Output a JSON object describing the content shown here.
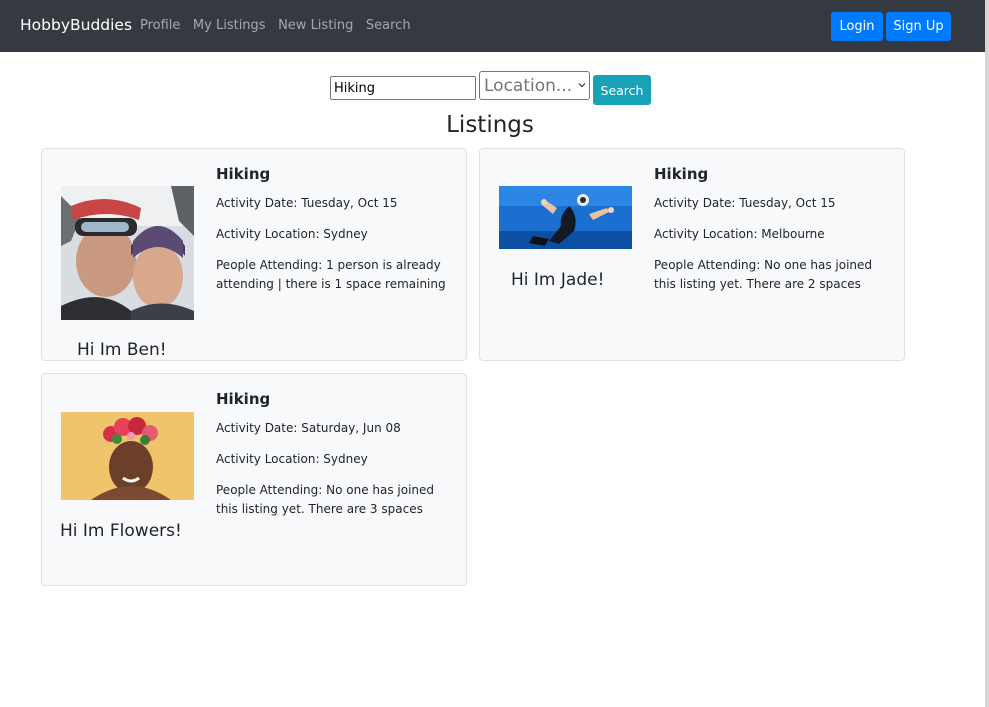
{
  "navbar": {
    "brand": "HobbyBuddies",
    "links": [
      "Profile",
      "My Listings",
      "New Listing",
      "Search"
    ],
    "login": "Login",
    "signup": "Sign Up",
    "bg_color": "#343a40"
  },
  "search": {
    "query": "Hiking",
    "location_placeholder": "Location...",
    "button": "Search",
    "button_color": "#17a2b8"
  },
  "heading": "Listings",
  "listings": [
    {
      "title": "Hiking",
      "date": "Activity Date: Tuesday, Oct 15",
      "location": "Activity Location: Sydney",
      "attending": "People Attending: 1 person is already attending | there is 1 space remaining",
      "greeting": "Hi Im Ben!",
      "photo_icon": "couple-selfie-photo"
    },
    {
      "title": "Hiking",
      "date": "Activity Date: Tuesday, Oct 15",
      "location": "Activity Location: Melbourne",
      "attending": "People Attending: No one has joined this listing yet. There are 2 spaces",
      "greeting": "Hi Im Jade!",
      "photo_icon": "scuba-diver-photo"
    },
    {
      "title": "Hiking",
      "date": "Activity Date: Saturday, Jun 08",
      "location": "Activity Location: Sydney",
      "attending": "People Attending: No one has joined this listing yet. There are 3 spaces",
      "greeting": "Hi Im Flowers!",
      "photo_icon": "flower-crown-portrait-photo"
    }
  ],
  "colors": {
    "primary": "#007bff",
    "card_bg": "#f8f9fa"
  }
}
